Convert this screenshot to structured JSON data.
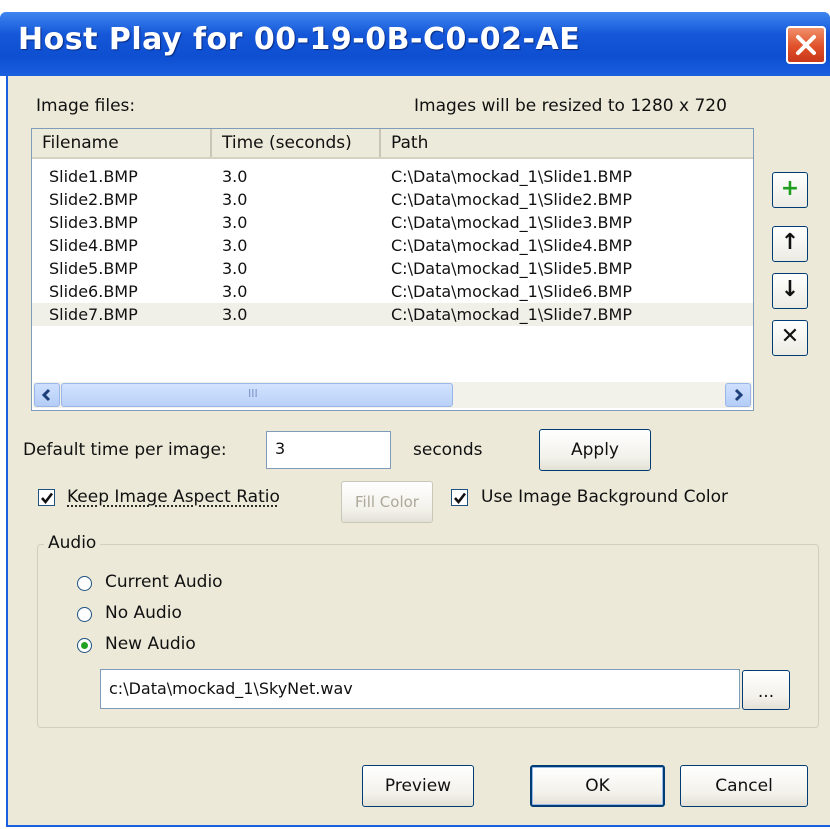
{
  "window": {
    "title": "Host Play for 00-19-0B-C0-02-AE",
    "close_icon": "close-icon"
  },
  "image_files": {
    "label": "Image files:",
    "resize_note": "Images will be resized to 1280 x 720",
    "columns": [
      "Filename",
      "Time (seconds)",
      "Path"
    ],
    "rows": [
      {
        "filename": "Slide1.BMP",
        "time": "3.0",
        "path": "C:\\Data\\mockad_1\\Slide1.BMP"
      },
      {
        "filename": "Slide2.BMP",
        "time": "3.0",
        "path": "C:\\Data\\mockad_1\\Slide2.BMP"
      },
      {
        "filename": "Slide3.BMP",
        "time": "3.0",
        "path": "C:\\Data\\mockad_1\\Slide3.BMP"
      },
      {
        "filename": "Slide4.BMP",
        "time": "3.0",
        "path": "C:\\Data\\mockad_1\\Slide4.BMP"
      },
      {
        "filename": "Slide5.BMP",
        "time": "3.0",
        "path": "C:\\Data\\mockad_1\\Slide5.BMP"
      },
      {
        "filename": "Slide6.BMP",
        "time": "3.0",
        "path": "C:\\Data\\mockad_1\\Slide6.BMP"
      },
      {
        "filename": "Slide7.BMP",
        "time": "3.0",
        "path": "C:\\Data\\mockad_1\\Slide7.BMP"
      }
    ],
    "scrollbar_grip": "III",
    "side_buttons": {
      "add": "+",
      "up": "↑",
      "down": "↓",
      "remove": "✕"
    },
    "add_color": "#1f9e1f"
  },
  "timing": {
    "label": "Default time per image:",
    "value": "3",
    "unit": "seconds",
    "apply_label": "Apply"
  },
  "options": {
    "keep_aspect_label": "Keep Image Aspect Ratio",
    "keep_aspect_checked": true,
    "fill_color_label": "Fill Color",
    "use_bg_label": "Use Image Background Color",
    "use_bg_checked": true
  },
  "audio": {
    "legend": "Audio",
    "options": [
      "Current Audio",
      "No Audio",
      "New Audio"
    ],
    "selected": "New Audio",
    "file_path": "c:\\Data\\mockad_1\\SkyNet.wav",
    "browse_label": "..."
  },
  "footer": {
    "preview_label": "Preview",
    "ok_label": "OK",
    "cancel_label": "Cancel"
  },
  "colors": {
    "title_bar": "#1557d8",
    "dialog_bg": "#ece9d8",
    "close_button": "#e0502a"
  }
}
